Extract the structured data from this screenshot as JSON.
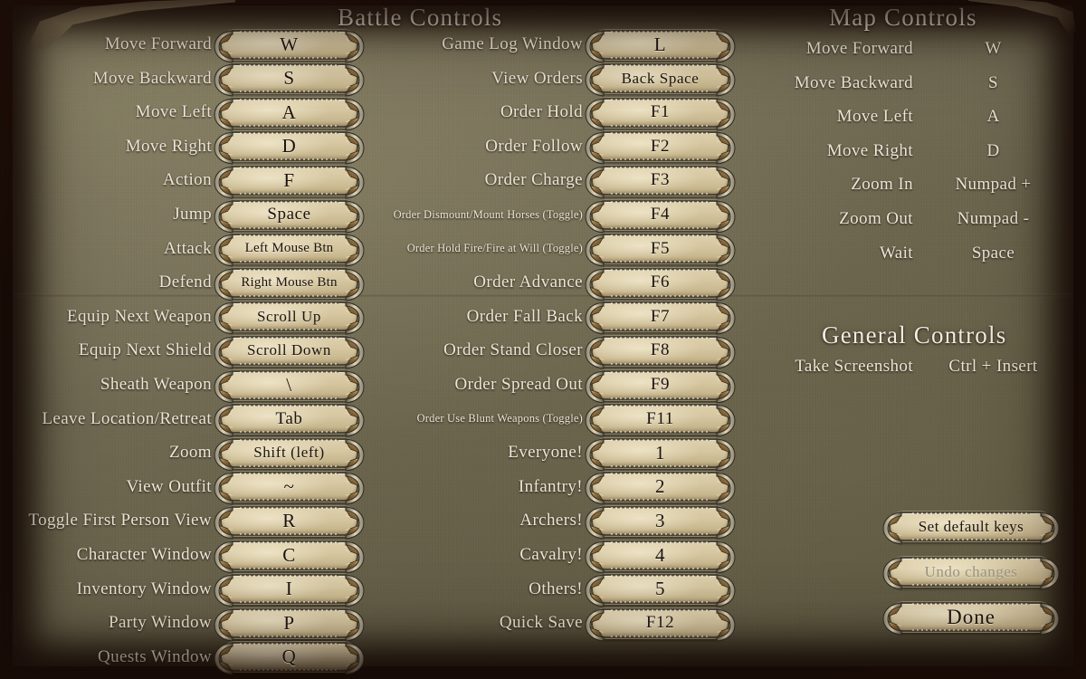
{
  "headings": {
    "battle": "Battle Controls",
    "map": "Map Controls",
    "general": "General Controls"
  },
  "battle_left": [
    {
      "label": "Move Forward",
      "key": "W"
    },
    {
      "label": "Move Backward",
      "key": "S"
    },
    {
      "label": "Move Left",
      "key": "A"
    },
    {
      "label": "Move Right",
      "key": "D"
    },
    {
      "label": "Action",
      "key": "F"
    },
    {
      "label": "Jump",
      "key": "Space"
    },
    {
      "label": "Attack",
      "key": "Left Mouse Btn"
    },
    {
      "label": "Defend",
      "key": "Right Mouse Btn"
    },
    {
      "label": "Equip Next Weapon",
      "key": "Scroll Up"
    },
    {
      "label": "Equip Next Shield",
      "key": "Scroll Down"
    },
    {
      "label": "Sheath Weapon",
      "key": "\\"
    },
    {
      "label": "Leave Location/Retreat",
      "key": "Tab"
    },
    {
      "label": "Zoom",
      "key": "Shift (left)"
    },
    {
      "label": "View Outfit",
      "key": "~"
    },
    {
      "label": "Toggle First Person View",
      "key": "R"
    },
    {
      "label": "Character Window",
      "key": "C"
    },
    {
      "label": "Inventory Window",
      "key": "I"
    },
    {
      "label": "Party Window",
      "key": "P"
    },
    {
      "label": "Quests Window",
      "key": "Q"
    }
  ],
  "battle_right": [
    {
      "label": "Game Log Window",
      "key": "L",
      "small": false
    },
    {
      "label": "View Orders",
      "key": "Back Space",
      "small": false
    },
    {
      "label": "Order Hold",
      "key": "F1",
      "small": false
    },
    {
      "label": "Order Follow",
      "key": "F2",
      "small": false
    },
    {
      "label": "Order Charge",
      "key": "F3",
      "small": false
    },
    {
      "label": "Order Dismount/Mount Horses (Toggle)",
      "key": "F4",
      "small": true
    },
    {
      "label": "Order Hold Fire/Fire at Will (Toggle)",
      "key": "F5",
      "small": true
    },
    {
      "label": "Order Advance",
      "key": "F6",
      "small": false
    },
    {
      "label": "Order Fall Back",
      "key": "F7",
      "small": false
    },
    {
      "label": "Order Stand Closer",
      "key": "F8",
      "small": false
    },
    {
      "label": "Order Spread Out",
      "key": "F9",
      "small": false
    },
    {
      "label": "Order Use Blunt Weapons (Toggle)",
      "key": "F11",
      "small": true
    },
    {
      "label": "Everyone!",
      "key": "1",
      "small": false
    },
    {
      "label": "Infantry!",
      "key": "2",
      "small": false
    },
    {
      "label": "Archers!",
      "key": "3",
      "small": false
    },
    {
      "label": "Cavalry!",
      "key": "4",
      "small": false
    },
    {
      "label": "Others!",
      "key": "5",
      "small": false
    },
    {
      "label": "Quick Save",
      "key": "F12",
      "small": false
    }
  ],
  "map_controls": [
    {
      "label": "Move Forward",
      "key": "W"
    },
    {
      "label": "Move Backward",
      "key": "S"
    },
    {
      "label": "Move Left",
      "key": "A"
    },
    {
      "label": "Move Right",
      "key": "D"
    },
    {
      "label": "Zoom In",
      "key": "Numpad +"
    },
    {
      "label": "Zoom Out",
      "key": "Numpad -"
    },
    {
      "label": "Wait",
      "key": "Space"
    }
  ],
  "general_controls": [
    {
      "label": "Take Screenshot",
      "key": "Ctrl + Insert"
    }
  ],
  "actions": [
    {
      "label": "Set default keys",
      "disabled": false,
      "big": false
    },
    {
      "label": "Undo changes",
      "disabled": true,
      "big": false
    },
    {
      "label": "Done",
      "disabled": false,
      "big": true
    }
  ],
  "colors": {
    "parchment": "#6d6750",
    "button_face": "#d6c7a1",
    "button_border": "#4c4639",
    "text_light": "#ece6d8",
    "text_dark": "#1c1410",
    "disabled_text": "#9a9280",
    "backdrop": "#140a06"
  }
}
